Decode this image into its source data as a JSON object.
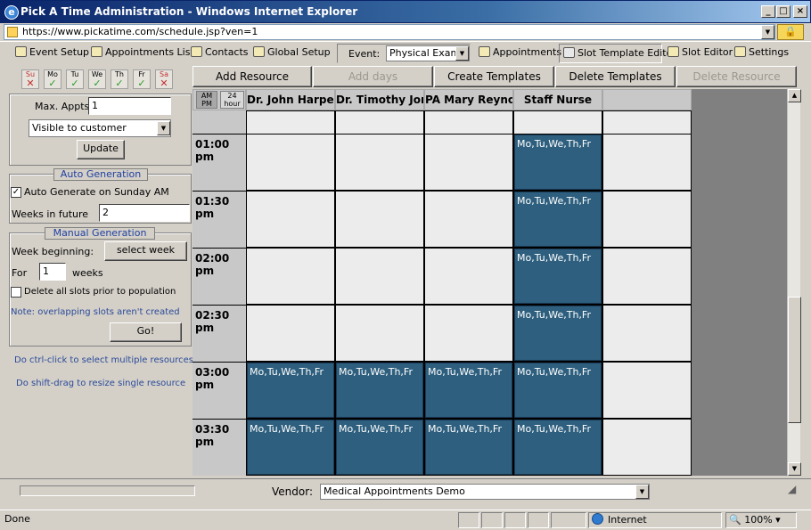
{
  "window": {
    "title": "Pick A Time Administration - Windows Internet Explorer",
    "min_glyph": "_",
    "max_glyph": "□",
    "close_glyph": "×"
  },
  "address": {
    "url": "https://www.pickatime.com/schedule.jsp?ven=1"
  },
  "toolbar": {
    "event_setup": "Event Setup",
    "appointments_list": "Appointments List",
    "contacts": "Contacts",
    "global_setup": "Global Setup",
    "event_label": "Event:",
    "event_value": "Physical Exam",
    "appointments": "Appointments",
    "slot_template_editor": "Slot Template Editor",
    "slot_editor": "Slot Editor",
    "settings": "Settings"
  },
  "days": [
    {
      "label": "Su",
      "mark": "✕",
      "state": "off"
    },
    {
      "label": "Mo",
      "mark": "✓",
      "state": "on"
    },
    {
      "label": "Tu",
      "mark": "✓",
      "state": "on"
    },
    {
      "label": "We",
      "mark": "✓",
      "state": "on"
    },
    {
      "label": "Th",
      "mark": "✓",
      "state": "on"
    },
    {
      "label": "Fr",
      "mark": "✓",
      "state": "on"
    },
    {
      "label": "Sa",
      "mark": "✕",
      "state": "off"
    }
  ],
  "left": {
    "max_appts_label": "Max. Appts",
    "max_appts_value": "1",
    "visibility_value": "Visible to customer",
    "update_label": "Update",
    "auto_generation_title": "Auto Generation",
    "auto_generate_label": "Auto Generate on Sunday AM",
    "auto_generate_checked": "✓",
    "weeks_in_future_label": "Weeks in future",
    "weeks_in_future_value": "2",
    "manual_generation_title": "Manual Generation",
    "week_beginning_label": "Week beginning:",
    "select_week_label": "select week",
    "for_label": "For",
    "for_value": "1",
    "weeks_label": "weeks",
    "delete_slots_label": "Delete all slots prior to population",
    "note_overlap": "Note: overlapping slots aren't created",
    "go_label": "Go!",
    "hint_ctrl": "Do ctrl-click to select multiple resources",
    "hint_shift": "Do shift-drag to resize single resource"
  },
  "actions": {
    "add_resource": "Add Resource",
    "add_days": "Add days",
    "create_templates": "Create Templates",
    "delete_templates": "Delete Templates",
    "delete_resource": "Delete Resource"
  },
  "grid": {
    "toggle_ampm": "AM\nPM",
    "toggle_24": "24\nhour",
    "columns": [
      "Dr. John Harper",
      "Dr. Timothy Jone",
      "PA Mary Reynold",
      "Staff Nurse",
      ""
    ],
    "times": [
      "01:00 pm",
      "01:30 pm",
      "02:00 pm",
      "02:30 pm",
      "03:00 pm",
      "03:30 pm"
    ],
    "slot_text": "Mo,Tu,We,Th,Fr",
    "slot_color": "#2e5f7e"
  },
  "bottom": {
    "vendor_label": "Vendor:",
    "vendor_value": "Medical Appointments Demo"
  },
  "status": {
    "text": "Done",
    "zone": "Internet",
    "zoom": "100%"
  }
}
